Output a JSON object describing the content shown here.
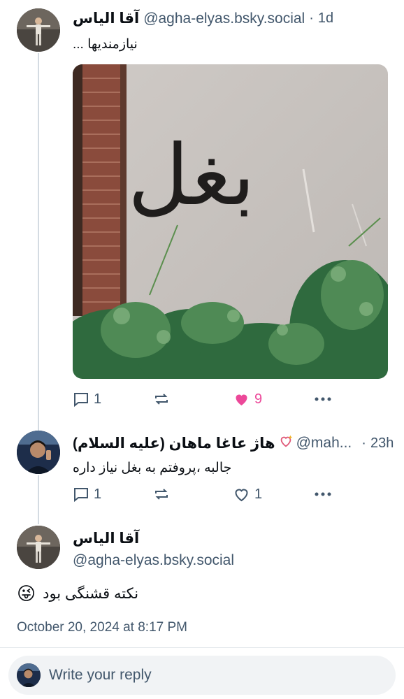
{
  "post1": {
    "display_name": "آقا الیاس",
    "handle": "@agha-elyas.bsky.social",
    "separator": "·",
    "time": "1d",
    "text": "نیازمندیها ...",
    "image_text": "بغل",
    "reply_count": "1",
    "like_count": "9",
    "liked": true,
    "like_color": "#ec4899"
  },
  "post2": {
    "display_name": "هاژ عاغا ماهان (علیه السلام)",
    "handle": "@mah...",
    "separator": "·",
    "time": "23h",
    "text": "جالبه ،پروفتم به بغل نیاز داره",
    "reply_count": "1",
    "like_count": "1",
    "liked": false
  },
  "focus": {
    "display_name": "آقا الیاس",
    "handle": "@agha-elyas.bsky.social",
    "text": "نکته قشنگی بود",
    "emoji": "😜",
    "timestamp": "October 20, 2024 at 8:17 PM"
  },
  "composer": {
    "placeholder": "Write your reply"
  },
  "colors": {
    "accent": "#1083fe",
    "muted": "#42576c",
    "line": "#d4dbe2"
  }
}
